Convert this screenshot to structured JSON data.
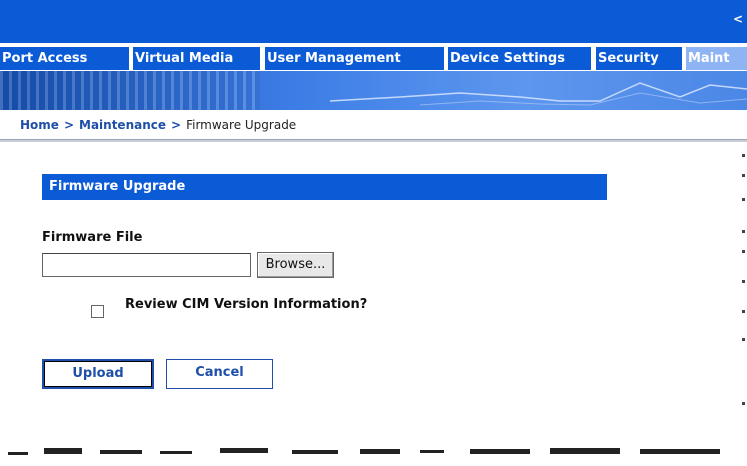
{
  "header": {
    "right_glyph": "<"
  },
  "tabs": [
    {
      "label": "Port Access",
      "active": false
    },
    {
      "label": "Virtual Media",
      "active": false
    },
    {
      "label": "User Management",
      "active": false
    },
    {
      "label": "Device Settings",
      "active": false
    },
    {
      "label": "Security",
      "active": false
    },
    {
      "label": "Maint",
      "active": true
    }
  ],
  "breadcrumb": {
    "items": [
      "Home",
      "Maintenance"
    ],
    "separator": ">",
    "current": "Firmware Upgrade"
  },
  "section": {
    "title": "Firmware Upgrade"
  },
  "form": {
    "firmware_file_label": "Firmware File",
    "firmware_file_value": "",
    "browse_label": "Browse...",
    "review_cim_label": "Review CIM Version Information?",
    "review_cim_checked": false
  },
  "buttons": {
    "upload_label": "Upload",
    "cancel_label": "Cancel"
  },
  "colors": {
    "primary": "#0b5bd6",
    "active_tab": "#8fb4f4",
    "link": "#1f4fa8"
  }
}
